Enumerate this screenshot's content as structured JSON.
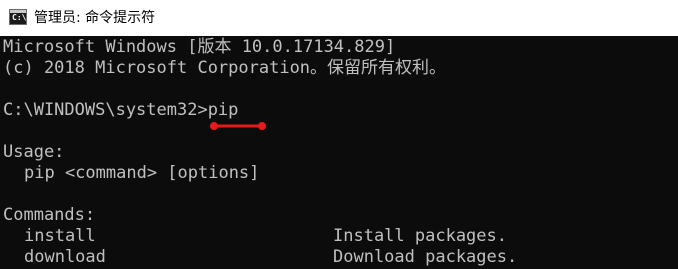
{
  "window": {
    "title": "管理员: 命令提示符",
    "icon": "cmd-icon",
    "icon_glyph": "C:\\"
  },
  "console": {
    "lines": {
      "version": "Microsoft Windows [版本 10.0.17134.829]",
      "copyright": "(c) 2018 Microsoft Corporation。保留所有权利。",
      "prompt": "C:\\WINDOWS\\system32>pip",
      "usage_header": "Usage:",
      "usage_line": "pip <command> [options]",
      "commands_header": "Commands:"
    },
    "commands": [
      {
        "name": "install",
        "description": "Install packages."
      },
      {
        "name": "download",
        "description": "Download packages."
      }
    ]
  },
  "colors": {
    "console_background": "#0c0c0c",
    "console_text": "#c0c0c0",
    "annotation": "#e8191a"
  }
}
